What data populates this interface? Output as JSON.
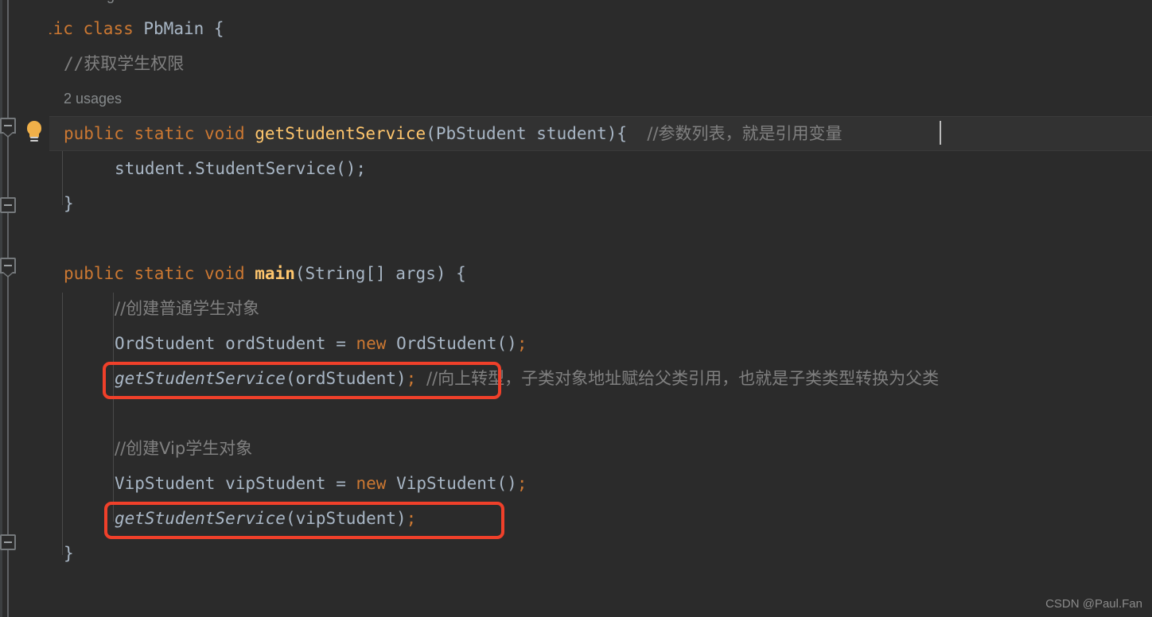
{
  "editor": {
    "background_color": "#2b2b2b",
    "current_line_color": "#323232",
    "font_size_px": 21,
    "line_height_px": 44
  },
  "colors": {
    "keyword": "#cc7832",
    "identifier": "#a9b7c6",
    "comment": "#808080",
    "method_declaration": "#ffc66d",
    "semicolon": "#cc7832",
    "annotation_box": "#f0402a",
    "inlay_hint": "#868a8c",
    "gutter_fold": "#75797c",
    "bulb": "#f0b049"
  },
  "gutter": {
    "bulb_icon": "lightbulb-icon",
    "fold_markers": [
      {
        "name": "fold-marker-getStudentService",
        "type": "expanded"
      },
      {
        "name": "fold-marker-class-body",
        "type": "collapsed-bar"
      },
      {
        "name": "fold-marker-main",
        "type": "expanded"
      }
    ]
  },
  "inlay_hints": {
    "no_usages": "no usages",
    "two_usages": "2 usages"
  },
  "code": {
    "line_class_decl": {
      "kw_public": "public",
      "kw_class": "class",
      "class_name": "PbMain",
      "brace": "{"
    },
    "comment_get_permission": "//获取学生权限",
    "line_method_decl": {
      "kw_public": "public",
      "kw_static": "static",
      "kw_void": "void",
      "method_name": "getStudentService",
      "params": "(PbStudent student){",
      "comment": "//参数列表，就是引用变量"
    },
    "line_service_call": "student.StudentService();",
    "brace_close_method": "}",
    "line_main_decl": {
      "kw_public": "public",
      "kw_static": "static",
      "kw_void": "void",
      "method_name": "main",
      "params": "(String[] args) {"
    },
    "comment_create_ord": "//创建普通学生对象",
    "line_ord_decl": {
      "type": "OrdStudent",
      "var": "ordStudent",
      "eq": "=",
      "kw_new": "new",
      "ctor": "OrdStudent()",
      "semi": ";"
    },
    "line_ord_call": {
      "method": "getStudentService",
      "args": "(ordStudent)",
      "semi": ";",
      "comment": "//向上转型，子类对象地址赋给父类引用，也就是子类类型转换为父类"
    },
    "comment_create_vip": "//创建Vip学生对象",
    "line_vip_decl": {
      "type": "VipStudent",
      "var": "vipStudent",
      "eq": "=",
      "kw_new": "new",
      "ctor": "VipStudent()",
      "semi": ";"
    },
    "line_vip_call": {
      "method": "getStudentService",
      "args": "(vipStudent)",
      "semi": ";"
    },
    "brace_close_main": "}",
    "brace_close_class": "}"
  },
  "annotations": {
    "box_ord_call": "red-highlight-box",
    "box_vip_call": "red-highlight-box"
  },
  "watermark": {
    "text": "CSDN @Paul.Fan"
  }
}
